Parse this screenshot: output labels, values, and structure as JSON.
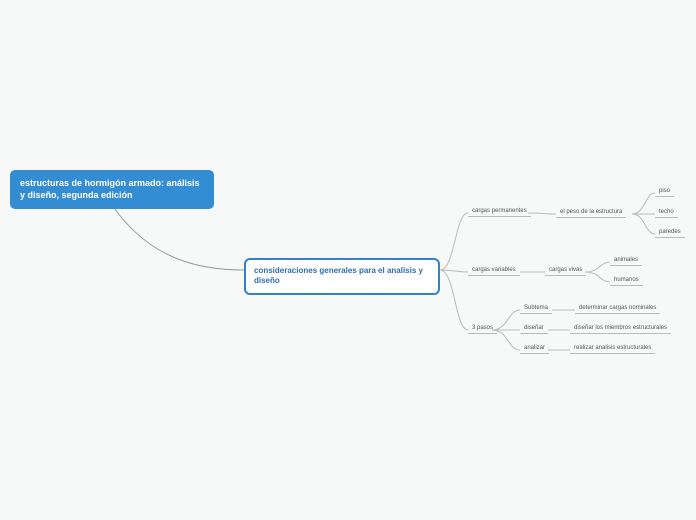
{
  "root": {
    "title": "estructuras de hormigón armado: análisis y diseño, segunda edición"
  },
  "subroot": {
    "title": "consideraciones generales para el analisis y diseño"
  },
  "branches": {
    "b1": {
      "label": "cargas permanentes"
    },
    "b2": {
      "label": "cargas variables"
    },
    "b3": {
      "label": "3 pasos"
    }
  },
  "b1_children": {
    "c1": {
      "label": "el peso de la estructura"
    }
  },
  "b1_c1_children": {
    "g1": {
      "label": "piso"
    },
    "g2": {
      "label": "techo"
    },
    "g3": {
      "label": "paredes"
    }
  },
  "b2_children": {
    "c1": {
      "label": "cargas vivas"
    }
  },
  "b2_c1_children": {
    "g1": {
      "label": "animales"
    },
    "g2": {
      "label": "humanos"
    }
  },
  "b3_children": {
    "c1": {
      "label": "Subtema"
    },
    "c2": {
      "label": "diseñar"
    },
    "c3": {
      "label": "analizar"
    }
  },
  "b3_grandchildren": {
    "g1": {
      "label": "determinar cargas nominales"
    },
    "g2": {
      "label": "diseñar los miembros estructurales"
    },
    "g3": {
      "label": "realizar analisis estructurales"
    }
  }
}
